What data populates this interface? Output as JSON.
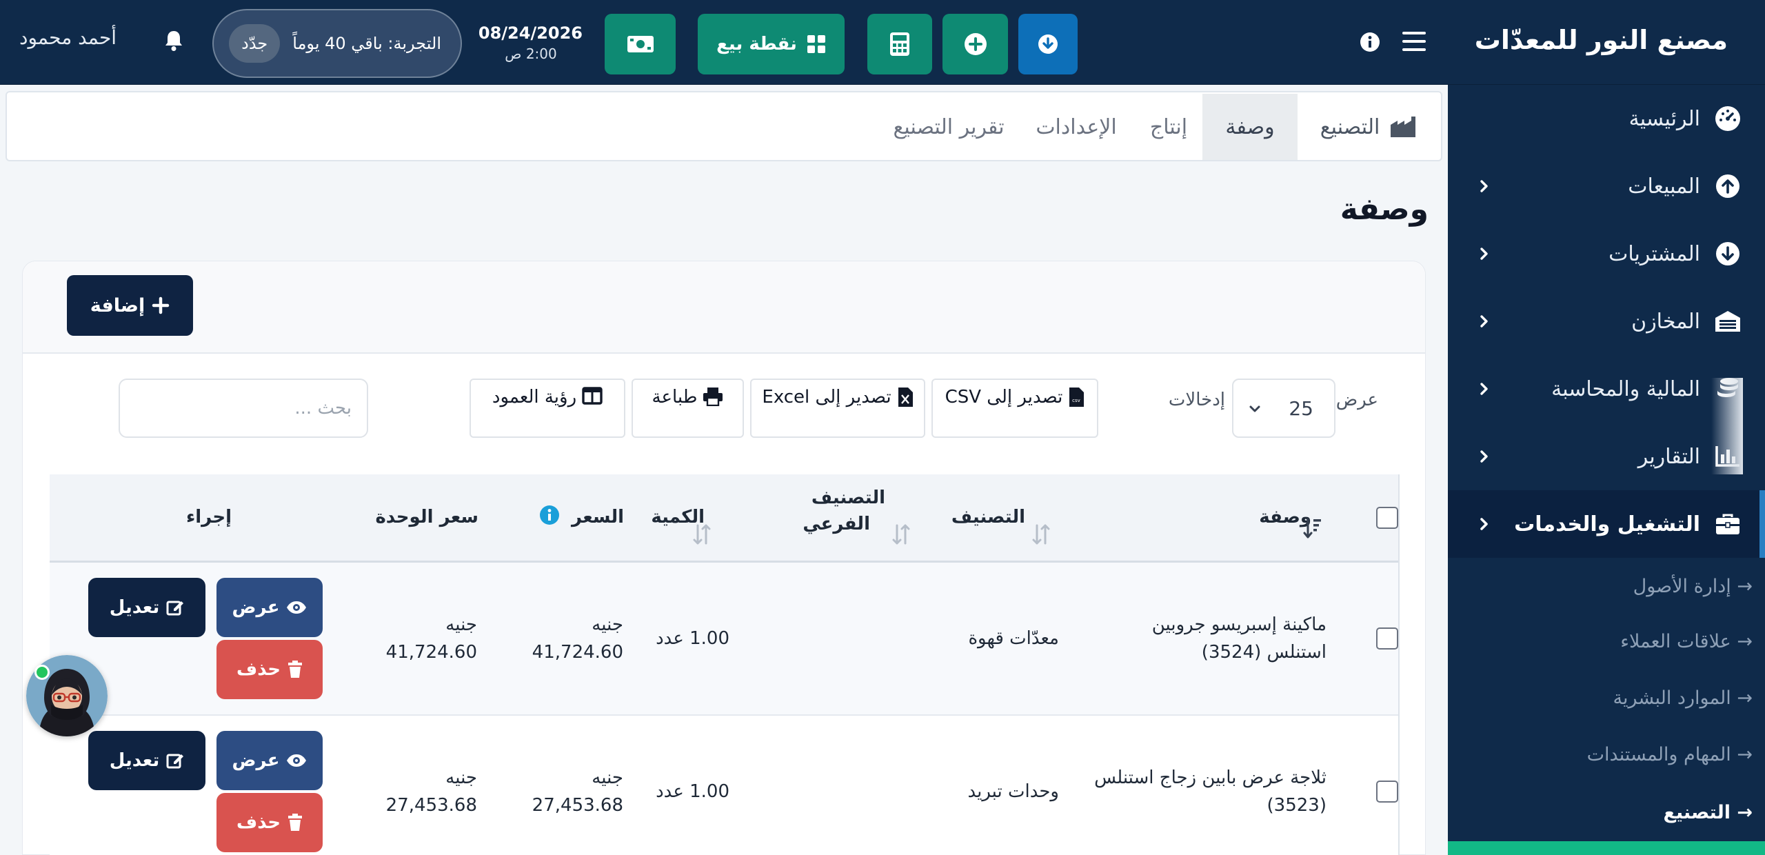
{
  "app": {
    "brand_title": "مصنع النور للمعدّات",
    "colors": {
      "topbar": "#0f2a4a",
      "teal": "#0e8a73",
      "blue": "#0d6fb8",
      "danger": "#d9534f",
      "dark_button": "#0f2342"
    }
  },
  "topbar": {
    "pos_label": "نقطة بيع",
    "date": "08/24/2026",
    "time": "2:00 ص",
    "trial_text": "التجربة: باقي 40 يوماً",
    "renew_label": "جدّد",
    "username": "أحمد محمود",
    "icons": [
      "menu-icon",
      "info-icon",
      "download-icon",
      "plus-circle-icon",
      "calculator-icon",
      "grid-icon",
      "cash-icon",
      "bell-icon"
    ]
  },
  "sidebar": {
    "items": [
      {
        "label": "الرئيسية",
        "icon": "dashboard-icon",
        "has_children": false
      },
      {
        "label": "المبيعات",
        "icon": "arrow-up-circle-icon",
        "has_children": true
      },
      {
        "label": "المشتريات",
        "icon": "arrow-down-circle-icon",
        "has_children": true
      },
      {
        "label": "المخازن",
        "icon": "warehouse-icon",
        "has_children": true
      },
      {
        "label": "المالية والمحاسبة",
        "icon": "coins-icon",
        "has_children": true
      },
      {
        "label": "التقارير",
        "icon": "chart-icon",
        "has_children": true
      },
      {
        "label": "التشغيل والخدمات",
        "icon": "briefcase-icon",
        "has_children": true,
        "active": true
      }
    ],
    "subitems": [
      {
        "label": "→ إدارة الأصول"
      },
      {
        "label": "→ علاقات العملاء"
      },
      {
        "label": "→ الموارد البشرية"
      },
      {
        "label": "→ المهام والمستندات"
      },
      {
        "label": "→ التصنيع",
        "current": true
      }
    ]
  },
  "tabs": [
    {
      "label": "التصنيع",
      "icon": "factory-icon"
    },
    {
      "label": "وصفة",
      "active": true
    },
    {
      "label": "إنتاج"
    },
    {
      "label": "الإعدادات"
    },
    {
      "label": "تقرير التصنيع"
    }
  ],
  "page": {
    "title": "وصفة",
    "add_label": "إضافة"
  },
  "table_controls": {
    "show_label": "عرض",
    "page_length": "25",
    "entries_label": "إدخالات",
    "export_csv": "تصدير إلى CSV",
    "export_excel": "تصدير إلى Excel",
    "print": "طباعة",
    "column_visibility": "رؤية العمود",
    "search_placeholder": "بحث ..."
  },
  "table": {
    "columns": {
      "recipe": "وصفة",
      "category": "التصنيف",
      "subcategory_line1": "التصنيف",
      "subcategory_line2": "الفرعي",
      "quantity": "الكمية",
      "price": "السعر",
      "unit_price": "سعر الوحدة",
      "action": "إجراء"
    },
    "rows": [
      {
        "name_line1": "ماكينة إسبريسو جروبين",
        "name_line2": "استنلس (3524)",
        "category": "معدّات قهوة",
        "subcategory": "",
        "quantity": "1.00 عدد",
        "price_currency": "جنيه",
        "price_value": "41,724.60",
        "unit_currency": "جنيه",
        "unit_value": "41,724.60"
      },
      {
        "name_line1": "ثلاجة عرض بابين زجاج استنلس",
        "name_line2": "(3523)",
        "category": "وحدات تبريد",
        "subcategory": "",
        "quantity": "1.00 عدد",
        "price_currency": "جنيه",
        "price_value": "27,453.68",
        "unit_currency": "جنيه",
        "unit_value": "27,453.68"
      }
    ],
    "actions": {
      "view": "عرض",
      "edit": "تعديل",
      "delete": "حذف"
    }
  }
}
